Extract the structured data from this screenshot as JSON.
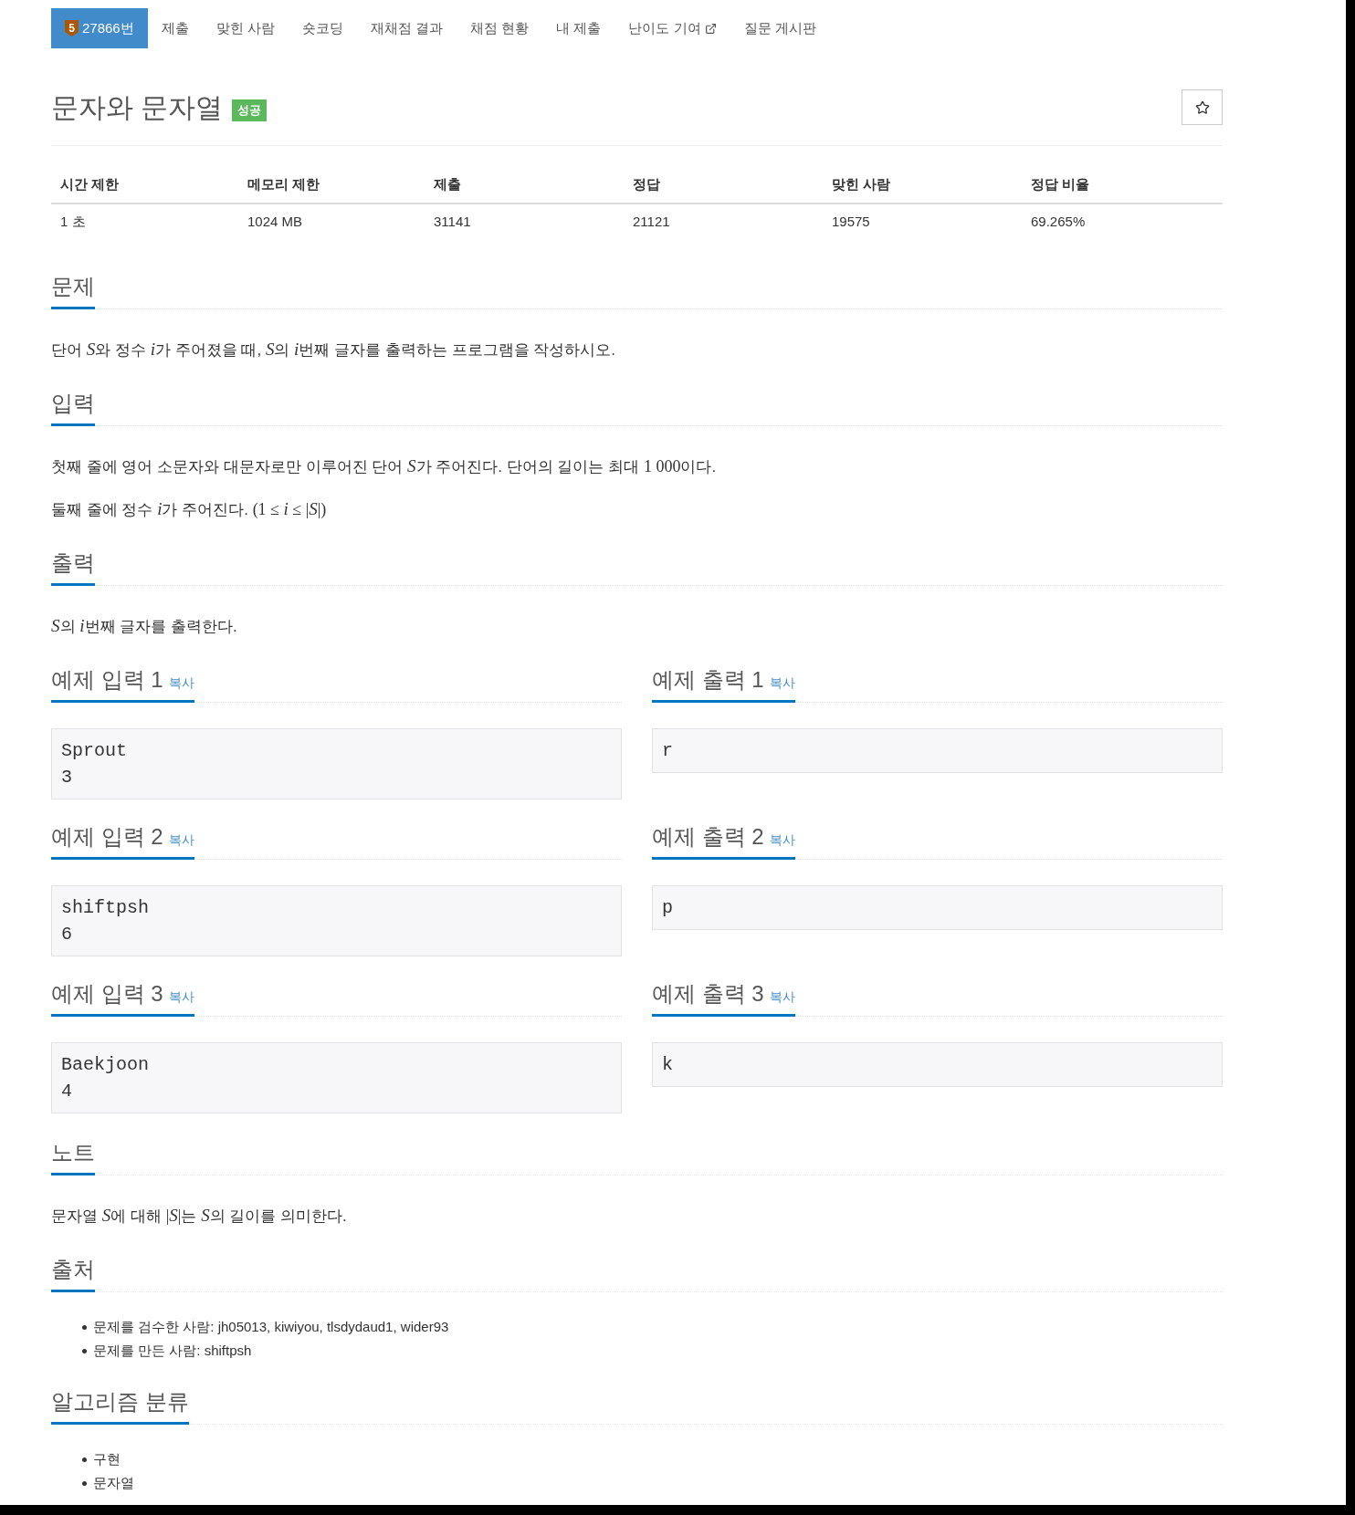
{
  "nav": {
    "tabs": [
      {
        "label": "27866번",
        "tier": "5",
        "selected": true,
        "external": false
      },
      {
        "label": "제출",
        "selected": false,
        "external": false
      },
      {
        "label": "맞힌 사람",
        "selected": false,
        "external": false
      },
      {
        "label": "숏코딩",
        "selected": false,
        "external": false
      },
      {
        "label": "재채점 결과",
        "selected": false,
        "external": false
      },
      {
        "label": "채점 현황",
        "selected": false,
        "external": false
      },
      {
        "label": "내 제출",
        "selected": false,
        "external": false
      },
      {
        "label": "난이도 기여",
        "selected": false,
        "external": true
      },
      {
        "label": "질문 게시판",
        "selected": false,
        "external": false
      }
    ]
  },
  "problem": {
    "title": "문자와 문자열",
    "status": {
      "label": "성공",
      "kind": "success"
    },
    "favorite": {
      "on": false
    }
  },
  "stats": {
    "columns": [
      "시간 제한",
      "메모리 제한",
      "제출",
      "정답",
      "맞힌 사람",
      "정답 비율"
    ],
    "rows": [
      [
        "1 초",
        "1024 MB",
        "31141",
        "21121",
        "19575",
        "69.265%"
      ]
    ]
  },
  "sections": [
    {
      "kind": "text",
      "heading": "문제",
      "paragraphs": [
        [
          {
            "kind": "text",
            "text": "단어 "
          },
          {
            "kind": "var",
            "text": "S"
          },
          {
            "kind": "text",
            "text": "와 정수 "
          },
          {
            "kind": "var",
            "text": "i"
          },
          {
            "kind": "text",
            "text": "가 주어졌을 때, "
          },
          {
            "kind": "var",
            "text": "S"
          },
          {
            "kind": "text",
            "text": "의 "
          },
          {
            "kind": "var",
            "text": "i"
          },
          {
            "kind": "text",
            "text": "번째 글자를 출력하는 프로그램을 작성하시오."
          }
        ]
      ]
    },
    {
      "kind": "text",
      "heading": "입력",
      "paragraphs": [
        [
          {
            "kind": "text",
            "text": "첫째 줄에 영어 소문자와 대문자로만 이루어진 단어 "
          },
          {
            "kind": "var",
            "text": "S"
          },
          {
            "kind": "text",
            "text": "가 주어진다. 단어의 길이는 최대 "
          },
          {
            "kind": "num",
            "text": "1 000"
          },
          {
            "kind": "text",
            "text": "이다."
          }
        ],
        [
          {
            "kind": "text",
            "text": "둘째 줄에 정수 "
          },
          {
            "kind": "var",
            "text": "i"
          },
          {
            "kind": "text",
            "text": "가 주어진다. "
          },
          {
            "kind": "num",
            "text": "(1 ≤ "
          },
          {
            "kind": "var",
            "text": "i"
          },
          {
            "kind": "num",
            "text": " ≤ |"
          },
          {
            "kind": "var",
            "text": "S"
          },
          {
            "kind": "num",
            "text": "|)"
          }
        ]
      ]
    },
    {
      "kind": "text",
      "heading": "출력",
      "paragraphs": [
        [
          {
            "kind": "var",
            "text": "S"
          },
          {
            "kind": "text",
            "text": "의 "
          },
          {
            "kind": "var",
            "text": "i"
          },
          {
            "kind": "text",
            "text": "번째 글자를 출력한다."
          }
        ]
      ]
    },
    {
      "kind": "examples",
      "pairs": [
        {
          "input": {
            "heading": "예제 입력 1",
            "copy": "복사",
            "text": "Sprout\n3"
          },
          "output": {
            "heading": "예제 출력 1",
            "copy": "복사",
            "text": "r"
          }
        },
        {
          "input": {
            "heading": "예제 입력 2",
            "copy": "복사",
            "text": "shiftpsh\n6"
          },
          "output": {
            "heading": "예제 출력 2",
            "copy": "복사",
            "text": "p"
          }
        },
        {
          "input": {
            "heading": "예제 입력 3",
            "copy": "복사",
            "text": "Baekjoon\n4"
          },
          "output": {
            "heading": "예제 출력 3",
            "copy": "복사",
            "text": "k"
          }
        }
      ]
    },
    {
      "kind": "text",
      "heading": "노트",
      "paragraphs": [
        [
          {
            "kind": "text",
            "text": "문자열 "
          },
          {
            "kind": "var",
            "text": "S"
          },
          {
            "kind": "text",
            "text": "에 대해 "
          },
          {
            "kind": "num",
            "text": "|"
          },
          {
            "kind": "var",
            "text": "S"
          },
          {
            "kind": "num",
            "text": "|"
          },
          {
            "kind": "text",
            "text": "는 "
          },
          {
            "kind": "var",
            "text": "S"
          },
          {
            "kind": "text",
            "text": "의 길이를 의미한다."
          }
        ]
      ]
    },
    {
      "kind": "list",
      "heading": "출처",
      "items": [
        "문제를 검수한 사람: jh05013, kiwiyou, tlsdydaud1, wider93",
        "문제를 만든 사람: shiftpsh"
      ]
    },
    {
      "kind": "list",
      "heading": "알고리즘 분류",
      "items": [
        "구현",
        "문자열"
      ]
    }
  ]
}
